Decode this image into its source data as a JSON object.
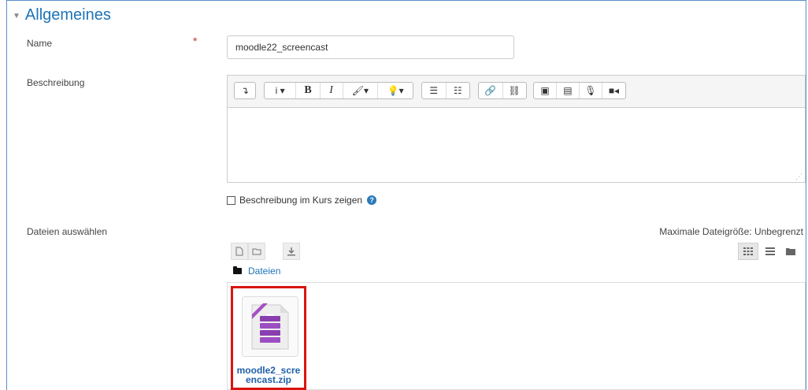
{
  "section": {
    "title": "Allgemeines"
  },
  "fields": {
    "name": {
      "label": "Name",
      "required_marker": "*",
      "value": "moodle22_screencast"
    },
    "description": {
      "label": "Beschreibung"
    },
    "show_description": {
      "label": "Beschreibung im Kurs zeigen",
      "checked": false,
      "help_glyph": "?"
    },
    "files": {
      "label": "Dateien auswählen"
    }
  },
  "toolbar": {
    "toggle": "↴",
    "info": "i ▾",
    "bold": "B",
    "italic": "I",
    "brush": "🖌▾",
    "light": "💡▾",
    "ul": "☰",
    "ol": "☷",
    "link": "🔗",
    "unlink": "⛓",
    "image": "▣",
    "media": "▤",
    "mic": "🎙",
    "video": "■◂"
  },
  "filepicker": {
    "max_size_text": "Maximale Dateigröße: Unbegrenzt",
    "breadcrumb": "Dateien",
    "files": [
      {
        "name_line1": "moodle2_scre",
        "name_line2": "encast.zip"
      }
    ]
  },
  "colors": {
    "accent": "#1f73b7",
    "highlight": "#d9150f",
    "required": "#c0392b"
  }
}
